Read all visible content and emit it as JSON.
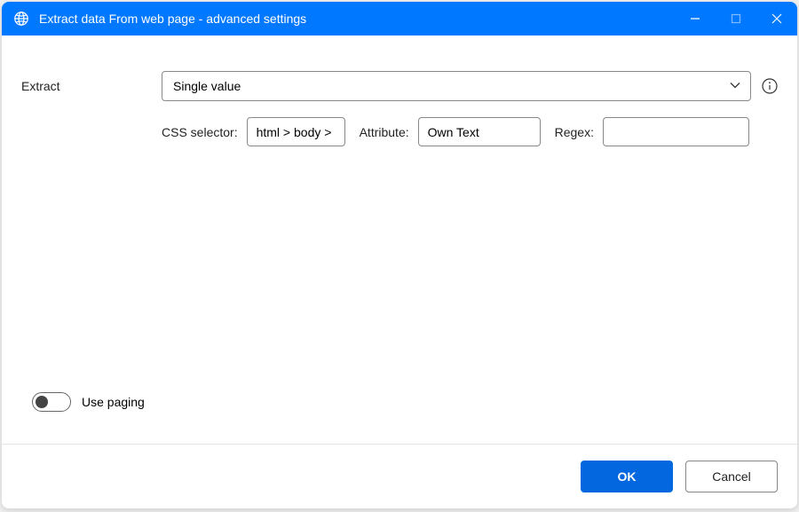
{
  "titlebar": {
    "title": "Extract data From web page - advanced settings"
  },
  "main": {
    "extract_label": "Extract",
    "extract_value": "Single value",
    "css_selector_label": "CSS selector:",
    "css_selector_value": "html > body >",
    "attribute_label": "Attribute:",
    "attribute_value": "Own Text",
    "regex_label": "Regex:",
    "regex_value": ""
  },
  "paging": {
    "label": "Use paging",
    "enabled": false
  },
  "footer": {
    "ok_label": "OK",
    "cancel_label": "Cancel"
  }
}
